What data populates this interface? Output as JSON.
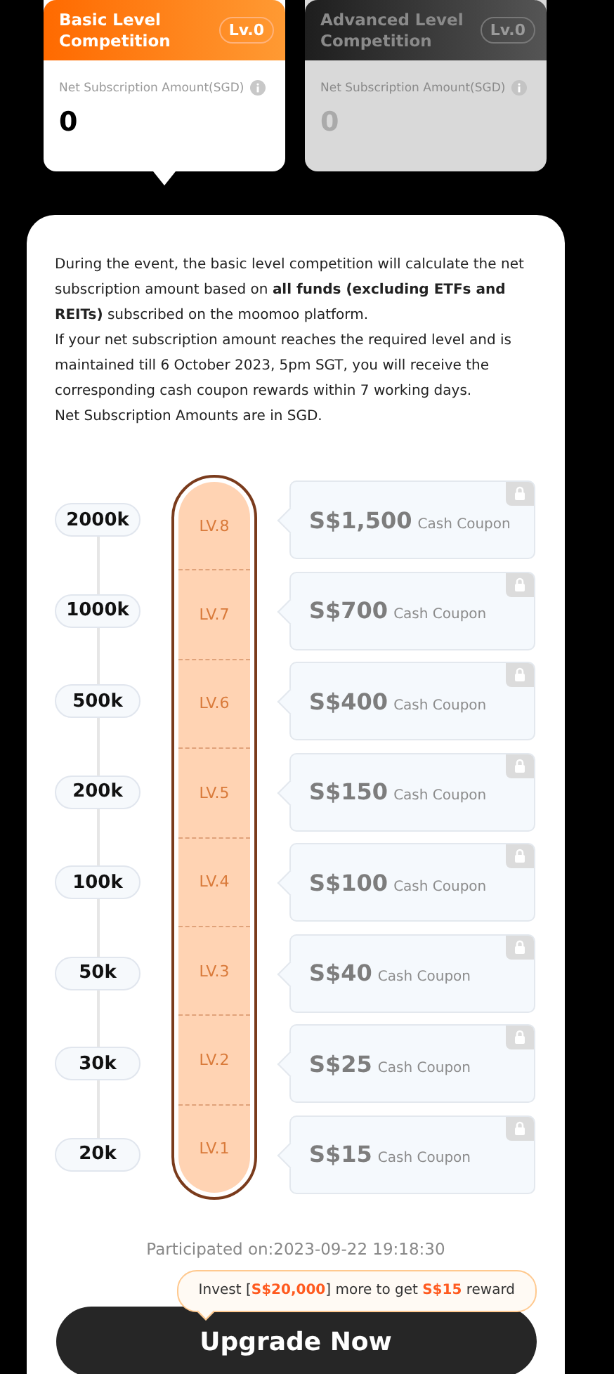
{
  "tabs": [
    {
      "title": "Basic Level Competition",
      "badge": "Lv.0",
      "amount_label": "Net Subscription Amount(SGD)",
      "amount": "0",
      "selected": true
    },
    {
      "title": "Advanced Level Competition",
      "badge": "Lv.0",
      "amount_label": "Net Subscription Amount(SGD)",
      "amount": "0",
      "selected": false
    }
  ],
  "description": [
    "During the event, the basic level competition will calculate the net subscription amount based on **all funds (excluding ETFs and REITs)** subscribed on the moomoo platform.",
    "If your net subscription amount reaches the required level and is maintained till 6 October 2023, 5pm SGT, you will receive the corresponding cash coupon rewards within 7 working days.",
    "Net Subscription Amounts are in SGD."
  ],
  "levels": [
    {
      "threshold": "2000k",
      "level": "LV.8",
      "amount": "S$1,500",
      "unit": "Cash Coupon",
      "locked": true
    },
    {
      "threshold": "1000k",
      "level": "LV.7",
      "amount": "S$700",
      "unit": "Cash Coupon",
      "locked": true
    },
    {
      "threshold": "500k",
      "level": "LV.6",
      "amount": "S$400",
      "unit": "Cash Coupon",
      "locked": true
    },
    {
      "threshold": "200k",
      "level": "LV.5",
      "amount": "S$150",
      "unit": "Cash Coupon",
      "locked": true
    },
    {
      "threshold": "100k",
      "level": "LV.4",
      "amount": "S$100",
      "unit": "Cash Coupon",
      "locked": true
    },
    {
      "threshold": "50k",
      "level": "LV.3",
      "amount": "S$40",
      "unit": "Cash Coupon",
      "locked": true
    },
    {
      "threshold": "30k",
      "level": "LV.2",
      "amount": "S$25",
      "unit": "Cash Coupon",
      "locked": true
    },
    {
      "threshold": "20k",
      "level": "LV.1",
      "amount": "S$15",
      "unit": "Cash Coupon",
      "locked": true
    }
  ],
  "participated": "Participated on:2023-09-22 19:18:30",
  "tooltip": "Invest [**S$20,000**] more to get **S$15** reward",
  "button": "Upgrade Now"
}
